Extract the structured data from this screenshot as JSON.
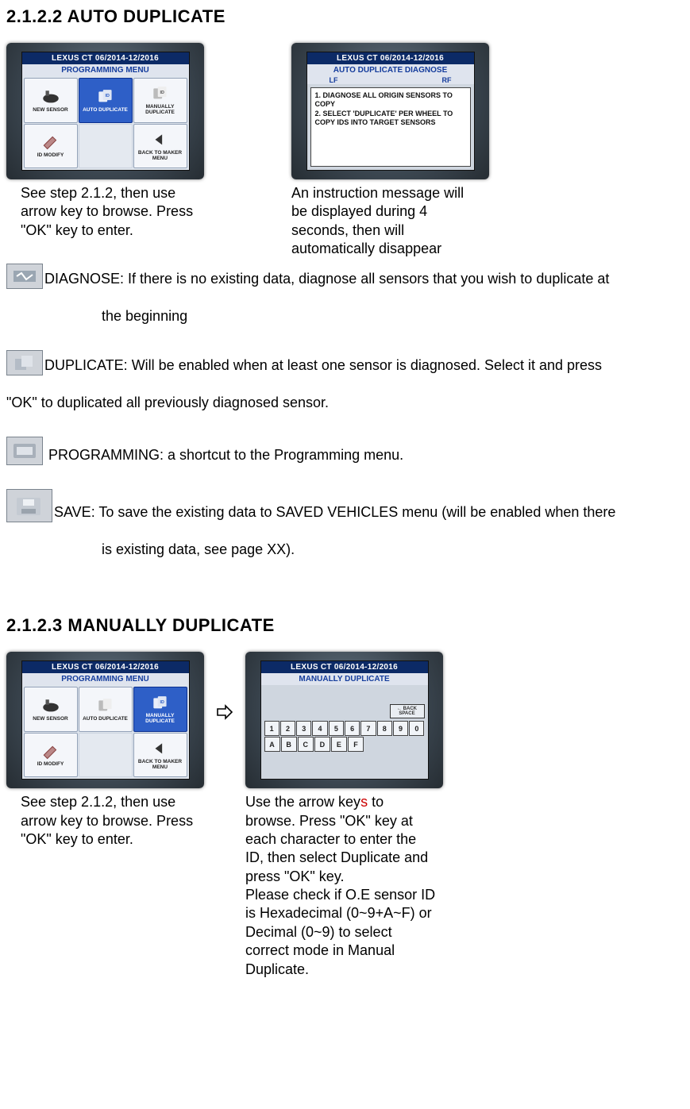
{
  "section1": {
    "heading": "2.1.2.2 AUTO DUPLICATE",
    "left_caption": "See step 2.1.2, then use arrow key to browse. Press \"OK\" key to enter.",
    "right_caption": "An instruction message will be displayed during 4 seconds, then will automatically disappear",
    "device_header": "LEXUS  CT  06/2014-12/2016",
    "prog_menu_title": "PROGRAMMING MENU",
    "tiles": {
      "new_sensor": "NEW SENSOR",
      "auto_dup": "AUTO DUPLICATE",
      "man_dup": "MANUALLY DUPLICATE",
      "id_modify": "ID MODIFY",
      "back": "BACK TO MAKER MENU"
    },
    "diag_title": "AUTO DUPLICATE DIAGNOSE",
    "lf": "LF",
    "rf": "RF",
    "diag_msg": "1. DIAGNOSE ALL ORIGIN SENSORS TO COPY\n2. SELECT  'DUPLICATE'  PER WHEEL TO COPY IDS INTO TARGET SENSORS"
  },
  "defs": {
    "diagnose_a": "DIAGNOSE: If there is no existing data, diagnose all sensors that you wish to duplicate at",
    "diagnose_b": "the beginning",
    "duplicate_a": "DUPLICATE: Will be enabled when at least one sensor is diagnosed. Select it and press",
    "duplicate_b": "\"OK\" to duplicated all previously diagnosed sensor.",
    "programming": " PROGRAMMING: a shortcut to the Programming menu.",
    "save_a": "SAVE: To save the existing data to SAVED VEHICLES menu (will be enabled when there",
    "save_b": "is existing data, see page XX)."
  },
  "section2": {
    "heading": "2.1.2.3 MANUALLY DUPLICATE",
    "left_caption": "See step 2.1.2, then use arrow key to browse. Press \"OK\" key to enter.",
    "right_caption_a": "Use the arrow key",
    "right_caption_s": "s",
    "right_caption_b": " to browse. Press \"OK\" key at each character to enter the ID, then select Duplicate and press \"OK\" key.",
    "right_caption_c": "Please check if O.E sensor ID is Hexadecimal (0~9+A~F) or Decimal (0~9) to select correct mode in Manual Duplicate.",
    "man_title": "MANUALLY DUPLICATE",
    "device_header2": "LEXUS  CT  06/2014-12/2016",
    "backspace": "← BACK SPACE",
    "row1": [
      "1",
      "2",
      "3",
      "4",
      "5",
      "6",
      "7",
      "8",
      "9",
      "0"
    ],
    "row2": [
      "A",
      "B",
      "C",
      "D",
      "E",
      "F"
    ]
  }
}
